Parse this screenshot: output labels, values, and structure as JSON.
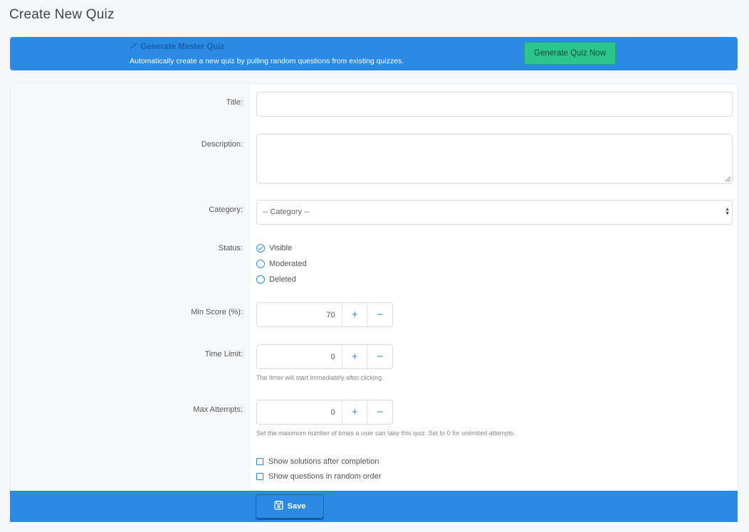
{
  "page": {
    "title": "Create New Quiz"
  },
  "banner": {
    "title": "Generate Master Quiz",
    "description": "Automatically create a new quiz by pulling random questions from existing quizzes.",
    "button_label": "Generate Quiz Now"
  },
  "form": {
    "title_label": "Title:",
    "title_value": "",
    "description_label": "Description:",
    "description_value": "",
    "category_label": "Category:",
    "category_selected": "-- Category --",
    "status_label": "Status:",
    "status_options": [
      {
        "label": "Visible",
        "checked": true
      },
      {
        "label": "Moderated",
        "checked": false
      },
      {
        "label": "Deleted",
        "checked": false
      }
    ],
    "min_score_label": "Min Score (%):",
    "min_score_value": "70",
    "time_limit_label": "Time Limit:",
    "time_limit_value": "0",
    "time_limit_help": "The timer will start immediately after clicking.",
    "max_attempts_label": "Max Attempts:",
    "max_attempts_value": "0",
    "max_attempts_help": "Set the maximum number of times a user can take this quiz. Set to 0 for unlimited attempts.",
    "checkboxes": [
      {
        "label": "Show solutions after completion",
        "checked": false
      },
      {
        "label": "Show questions in random order",
        "checked": false
      }
    ],
    "stepper_plus": "+",
    "stepper_minus": "−"
  },
  "footer": {
    "save_label": "Save"
  },
  "colors": {
    "primary": "#2b8ae3",
    "success": "#2ec48f",
    "background": "#f5f7fa"
  }
}
